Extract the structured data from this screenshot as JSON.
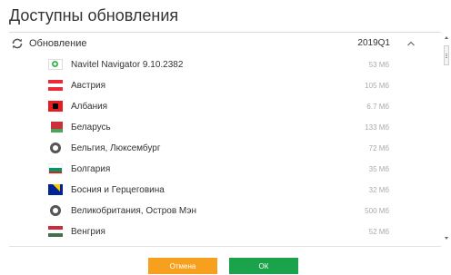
{
  "dialog": {
    "title": "Доступны обновления"
  },
  "group": {
    "label": "Обновление",
    "version": "2019Q1"
  },
  "items": [
    {
      "name": "Navitel Navigator 9.10.2382",
      "size": "53 Мб",
      "flag": "navitel"
    },
    {
      "name": "Австрия",
      "size": "105 Мб",
      "flag": "austria"
    },
    {
      "name": "Албания",
      "size": "6.7 Мб",
      "flag": "albania"
    },
    {
      "name": "Беларусь",
      "size": "133 Мб",
      "flag": "belarus"
    },
    {
      "name": "Бельгия, Люксембург",
      "size": "72 Мб",
      "flag": "globe"
    },
    {
      "name": "Болгария",
      "size": "35 Мб",
      "flag": "bulgaria"
    },
    {
      "name": "Босния и Герцеговина",
      "size": "32 Мб",
      "flag": "bosnia"
    },
    {
      "name": "Великобритания, Остров Мэн",
      "size": "500 Мб",
      "flag": "globe"
    },
    {
      "name": "Венгрия",
      "size": "52 Мб",
      "flag": "hungary"
    }
  ],
  "buttons": {
    "cancel": "Отмена",
    "ok": "ОК"
  },
  "colors": {
    "cancel": "#f7a01d",
    "ok": "#1aa34a"
  }
}
